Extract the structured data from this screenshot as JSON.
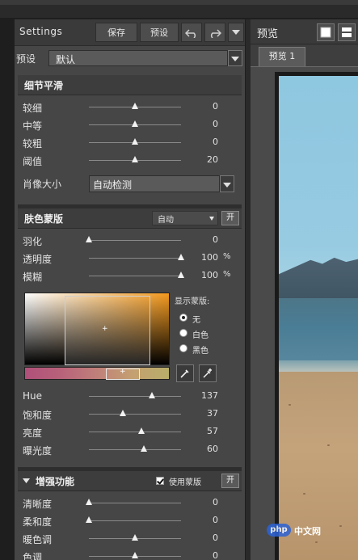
{
  "header": {
    "title": "Settings",
    "save_label": "保存",
    "preset_label": "预设",
    "undo_icon": "undo-icon",
    "redo_icon": "redo-icon"
  },
  "preset": {
    "label": "预设",
    "value": "默认"
  },
  "detail_smoothing": {
    "title": "细节平滑",
    "sliders": [
      {
        "name": "较细",
        "value": "0",
        "level": 0.5
      },
      {
        "name": "中等",
        "value": "0",
        "level": 0.5
      },
      {
        "name": "较粗",
        "value": "0",
        "level": 0.5
      },
      {
        "name": "阈值",
        "value": "20",
        "level": 0.5
      }
    ],
    "portrait_size_label": "肖像大小",
    "portrait_size_value": "自动检测"
  },
  "skin_mask": {
    "title": "肤色蒙版",
    "mode_value": "自动",
    "open_label": "开",
    "sliders": [
      {
        "name": "羽化",
        "value": "0",
        "unit": "",
        "level": 0.0
      },
      {
        "name": "透明度",
        "value": "100",
        "unit": "%",
        "level": 1.0
      },
      {
        "name": "模糊",
        "value": "100",
        "unit": "%",
        "level": 1.0
      }
    ],
    "display_mask_label": "显示蒙版:",
    "display_options": [
      {
        "label": "无",
        "selected": true
      },
      {
        "label": "白色",
        "selected": false
      },
      {
        "label": "黑色",
        "selected": false
      }
    ],
    "hsl_sliders": [
      {
        "name": "Hue",
        "value": "137",
        "level": 0.68
      },
      {
        "name": "饱和度",
        "value": "37",
        "level": 0.37
      },
      {
        "name": "亮度",
        "value": "57",
        "level": 0.57
      },
      {
        "name": "曝光度",
        "value": "60",
        "level": 0.6
      }
    ],
    "picker_accent": "#f49a1e"
  },
  "enhance": {
    "title": "增强功能",
    "use_mask_label": "使用蒙版",
    "use_mask_checked": true,
    "open_label": "开",
    "sliders": [
      {
        "name": "清晰度",
        "value": "0",
        "level": 0.0
      },
      {
        "name": "柔和度",
        "value": "0",
        "level": 0.0
      },
      {
        "name": "暖色调",
        "value": "0",
        "level": 0.5
      },
      {
        "name": "色调",
        "value": "0",
        "level": 0.5
      }
    ]
  },
  "preview": {
    "title": "预览",
    "tab_label": "预览 1",
    "watermark_logo": "php",
    "watermark_text": "中文网"
  }
}
